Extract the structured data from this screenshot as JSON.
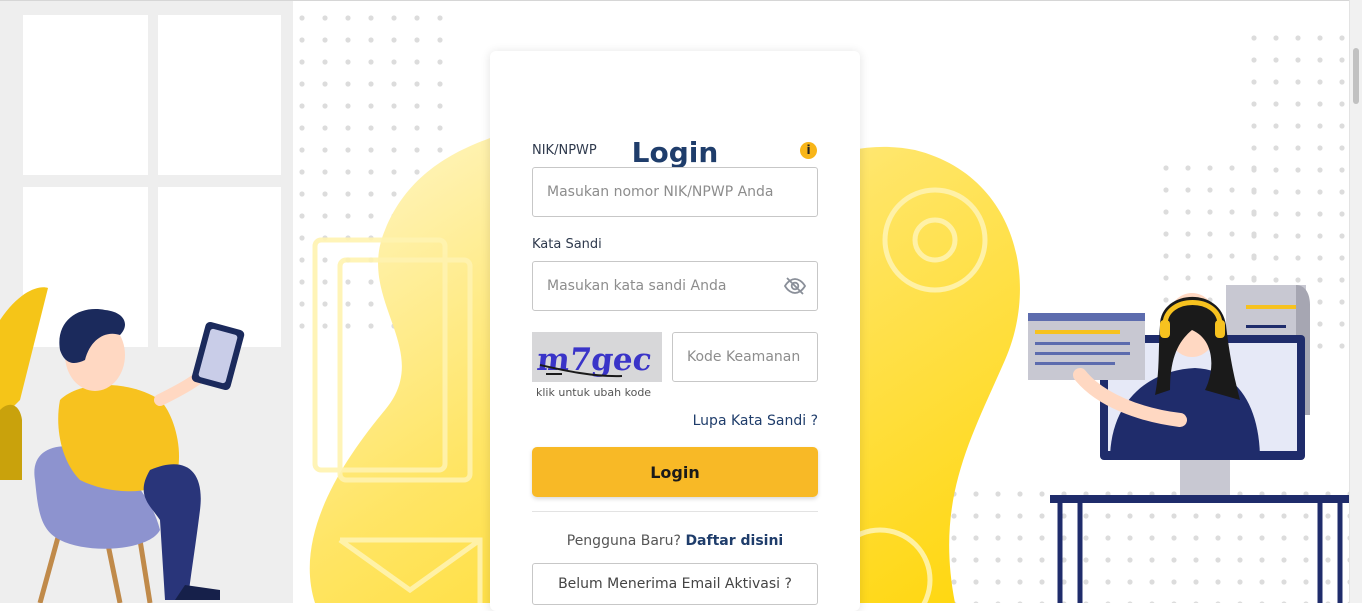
{
  "login": {
    "title": "Login",
    "nik_label": "NIK/NPWP",
    "nik_placeholder": "Masukan nomor NIK/NPWP Anda",
    "password_label": "Kata Sandi",
    "password_placeholder": "Masukan kata sandi Anda",
    "captcha_text": "m7gec",
    "captcha_hint": "klik untuk ubah kode",
    "captcha_placeholder": "Kode Keamanan",
    "forgot_link": "Lupa Kata Sandi ?",
    "login_button": "Login",
    "new_user_text": "Pengguna Baru?",
    "register_link": "Daftar disini",
    "activation_button": "Belum Menerima Email Aktivasi ?"
  },
  "icons": {
    "info": "info-icon",
    "password_visibility": "eye-slash-icon"
  },
  "colors": {
    "primary_navy": "#1f3d6b",
    "accent_yellow": "#f8b926",
    "info_yellow": "#f8b518"
  }
}
